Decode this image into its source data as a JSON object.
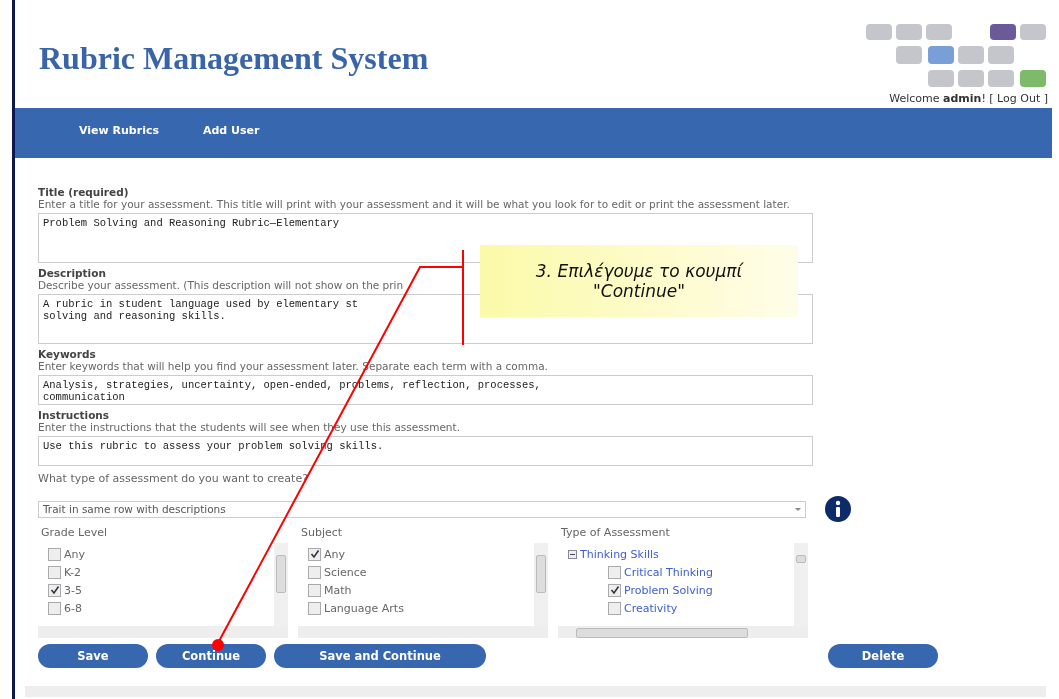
{
  "header": {
    "title": "Rubric Management System",
    "welcome": "Welcome ",
    "user": "admin",
    "welcome_end": "! [ ",
    "logout": "Log Out",
    "bracket": " ]"
  },
  "nav": [
    "View Rubrics",
    "Add User"
  ],
  "form": {
    "fields": [
      {
        "label": "Title (required)",
        "help": "Enter a title for your assessment. This title will print with your assessment and it will be what you look for to edit or print the assessment later.",
        "lines": [
          "Problem Solving and Reasoning Rubric—Elementary"
        ],
        "kind": "textarea"
      },
      {
        "label": "Description",
        "help": "Describe your assessment. (This description will not show on the prin",
        "lines": [
          "A rubric in student language used by elementary st",
          "solving and reasoning skills."
        ],
        "kind": "textarea"
      },
      {
        "label": "Keywords",
        "help": "Enter keywords that will help you find your assessment later. Separate each term with a comma.",
        "lines": [
          "Analysis, strategies, uncertainty, open-ended, problems, reflection, processes,",
          "communication"
        ],
        "kind": "textbox"
      },
      {
        "label": "Instructions",
        "help": "Enter the instructions that the students will see when they use this assessment.",
        "lines": [
          "Use this rubric to assess your problem solving skills."
        ],
        "kind": "textbox"
      }
    ],
    "type_question": "What type of assessment do you want to create?",
    "type_value": "Trait in same row with descriptions",
    "lists": [
      {
        "title": "Grade Level",
        "items": [
          {
            "label": "Any",
            "checked": false
          },
          {
            "label": "K-2",
            "checked": false
          },
          {
            "label": "3-5",
            "checked": true
          },
          {
            "label": "6-8",
            "checked": false
          }
        ]
      },
      {
        "title": "Subject",
        "items": [
          {
            "label": "Any",
            "checked": true
          },
          {
            "label": "Science",
            "checked": false
          },
          {
            "label": "Math",
            "checked": false
          },
          {
            "label": "Language Arts",
            "checked": false
          }
        ]
      }
    ],
    "tree": {
      "title": "Type of Assessment",
      "group": "Thinking Skills",
      "expanded": true,
      "items": [
        {
          "label": "Critical Thinking",
          "checked": false
        },
        {
          "label": "Problem Solving",
          "checked": true
        },
        {
          "label": "Creativity",
          "checked": false
        }
      ]
    },
    "buttons": [
      "Save",
      "Continue",
      "Save and Continue"
    ],
    "delete": "Delete"
  },
  "callout": {
    "lines": [
      "3. Επιλέγουμε το κουμπί",
      "\"Continue\""
    ]
  }
}
